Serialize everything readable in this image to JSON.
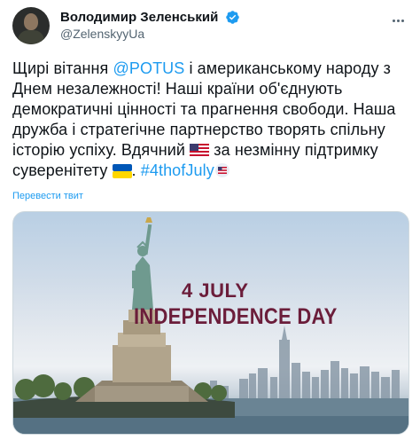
{
  "tweet": {
    "author_name": "Володимир Зеленський",
    "author_handle": "@ZelenskyyUa",
    "text_part1": "Щирі вітання ",
    "mention": "@POTUS",
    "text_part2": " і американському народу з Днем незалежності! Наші країни об'єднують демократичні цінності та прагнення свободи. Наша дружба і стратегічне партнерство творять спільну історію успіху. Вдячний ",
    "text_part3": " за незмінну підтримку суверенітету ",
    "text_part4": ". ",
    "hashtag": "#4thofJuly",
    "translate_label": "Перевести твит",
    "icons": {
      "verified": "verified-badge-icon",
      "more": "more-options-icon",
      "us_flag": "us-flag-emoji",
      "ua_flag": "ukraine-flag-emoji",
      "hashtag_emoji": "us-flag-hashtag-emoji"
    }
  },
  "media": {
    "image_line1": "4 JULY",
    "image_line2": "INDEPENDENCE DAY"
  },
  "colors": {
    "link": "#1d9bf0",
    "text": "#0f1419",
    "secondary": "#536471",
    "image_title": "#6b1d3a"
  }
}
